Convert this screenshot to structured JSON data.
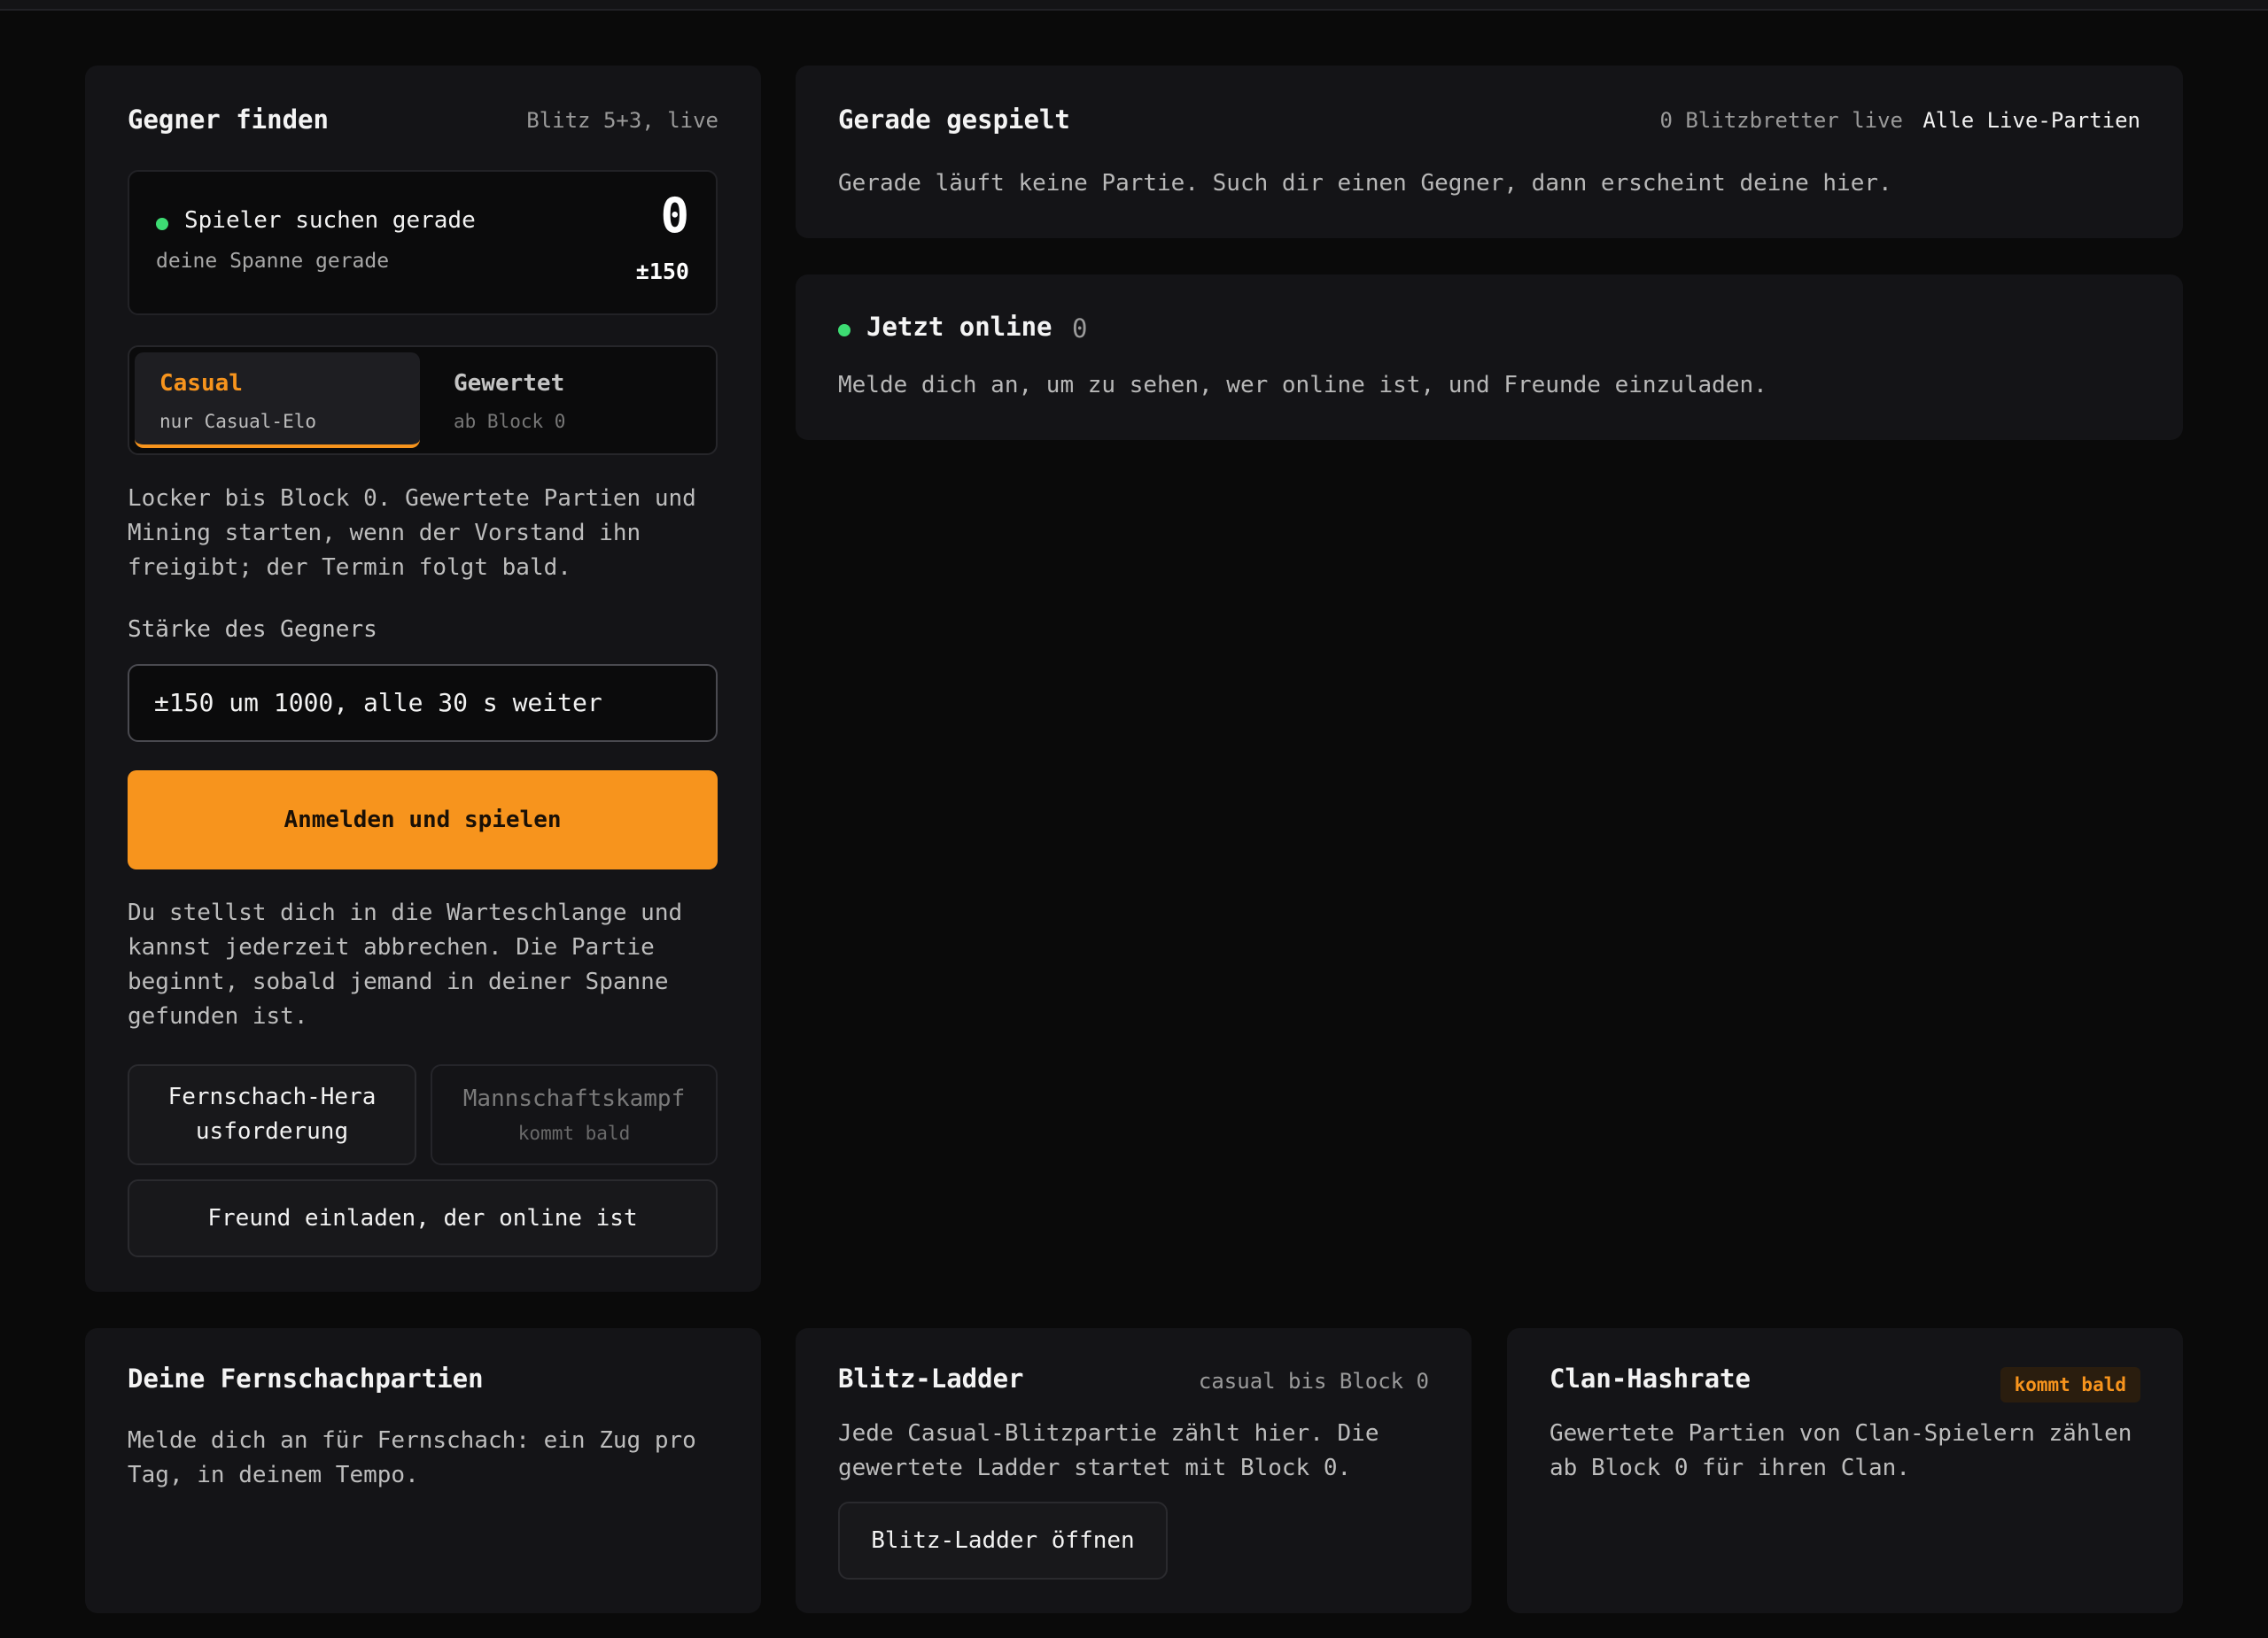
{
  "find": {
    "title": "Gegner finden",
    "meta": "Blitz 5+3, live",
    "status": {
      "label": "Spieler suchen gerade",
      "sub": "deine Spanne gerade",
      "count": "0",
      "range": "±150"
    },
    "modes": [
      {
        "label": "Casual",
        "sub": "nur Casual-Elo",
        "active": true
      },
      {
        "label": "Gewertet",
        "sub": "ab Block 0",
        "active": false
      }
    ],
    "locker_text": "Locker bis Block 0. Gewertete Partien und Mining starten, wenn der Vorstand ihn freigibt; der Termin folgt bald.",
    "strength_label": "Stärke des Gegners",
    "strength_value": "±150 um 1000, alle 30 s weiter",
    "cta": "Anmelden und spielen",
    "queue_text": "Du stellst dich in die Warteschlange und kannst jederzeit abbrechen. Die Partie beginnt, sobald jemand in deiner Spanne gefunden ist.",
    "correspondence_button": "Fernschach-Herausforderung",
    "team_button": {
      "label": "Mannschaftskampf",
      "sub": "kommt bald"
    },
    "invite_button": "Freund einladen, der online ist"
  },
  "recent": {
    "title": "Gerade gespielt",
    "meta": "0 Blitzbretter live",
    "link": "Alle Live-Partien",
    "text": "Gerade läuft keine Partie. Such dir einen Gegner, dann erscheint deine hier."
  },
  "online": {
    "title": "Jetzt online",
    "count": "0",
    "text": "Melde dich an, um zu sehen, wer online ist, und Freunde einzuladen."
  },
  "correspondence": {
    "title": "Deine Fernschachpartien",
    "text": "Melde dich an für Fernschach: ein Zug pro Tag, in deinem Tempo."
  },
  "ladder": {
    "title": "Blitz-Ladder",
    "meta": "casual bis Block 0",
    "text": "Jede Casual-Blitzpartie zählt hier. Die gewertete Ladder startet mit Block 0.",
    "button": "Blitz-Ladder öffnen"
  },
  "clan": {
    "title": "Clan-Hashrate",
    "badge": "kommt bald",
    "text": "Gewertete Partien von Clan-Spielern zählen ab Block 0 für ihren Clan."
  },
  "colors": {
    "accent": "#f7941d",
    "online": "#3ddc73",
    "background": "#0a0a0a",
    "card": "#141417"
  }
}
